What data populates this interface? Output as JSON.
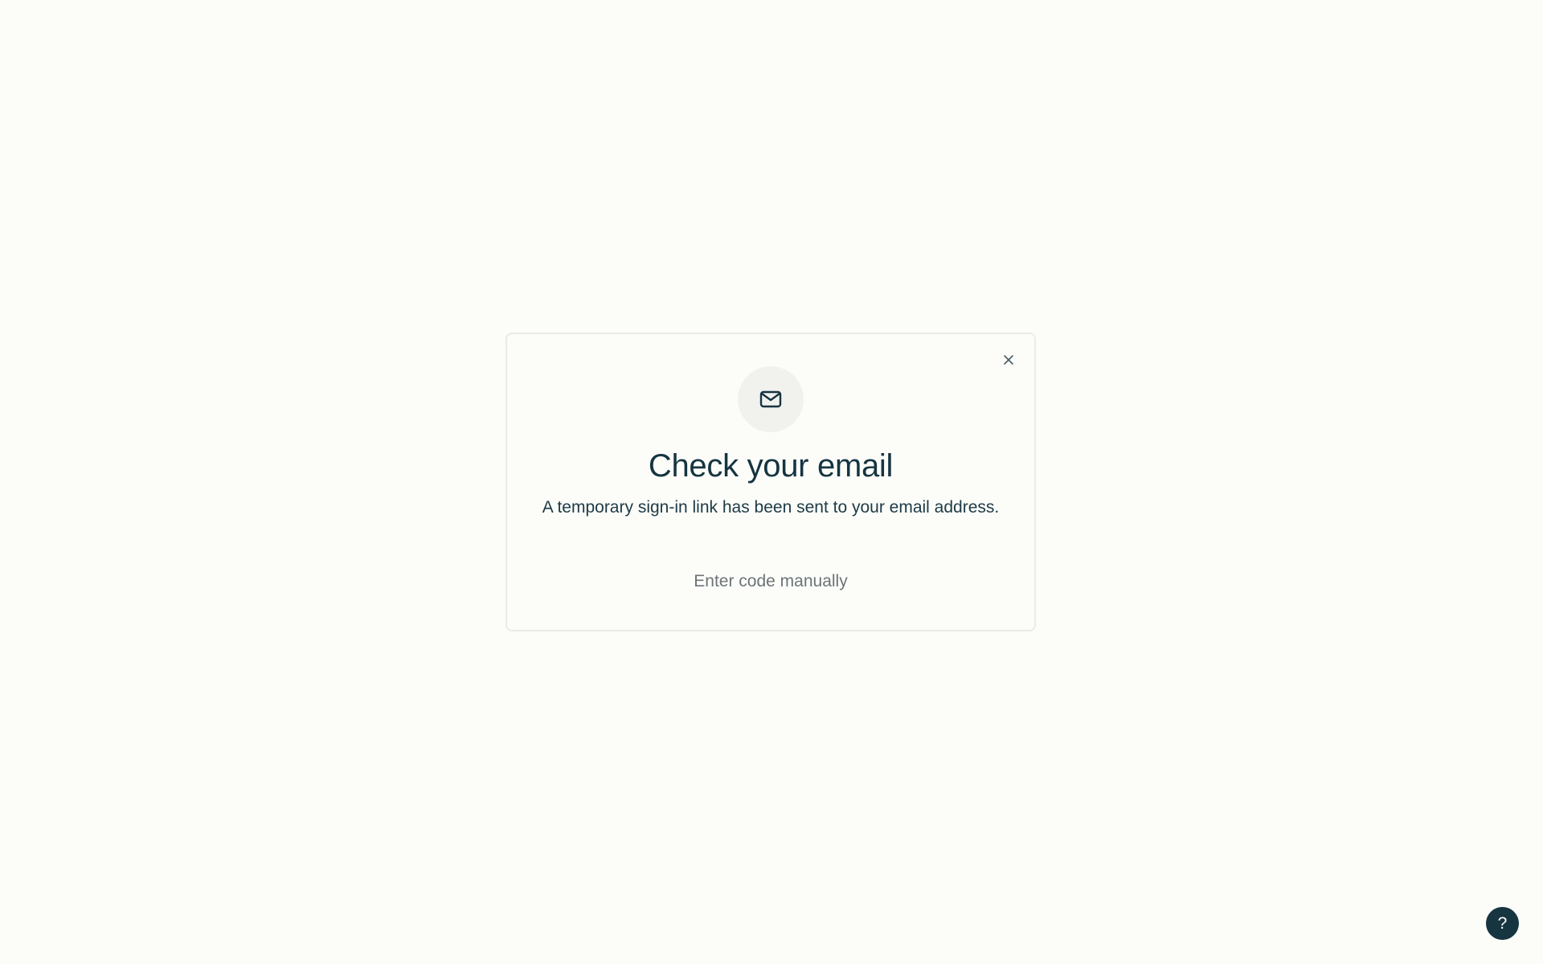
{
  "modal": {
    "title": "Check your email",
    "subtitle": "A temporary sign-in link has been sent to your email address.",
    "manual_link": "Enter code manually",
    "close_icon": "close-icon",
    "header_icon": "mail-icon"
  },
  "help": {
    "label": "?",
    "icon": "help-icon"
  },
  "colors": {
    "background": "#fcfdf9",
    "text_primary": "#163441",
    "text_muted": "#6c7478",
    "help_button": "#173441"
  }
}
